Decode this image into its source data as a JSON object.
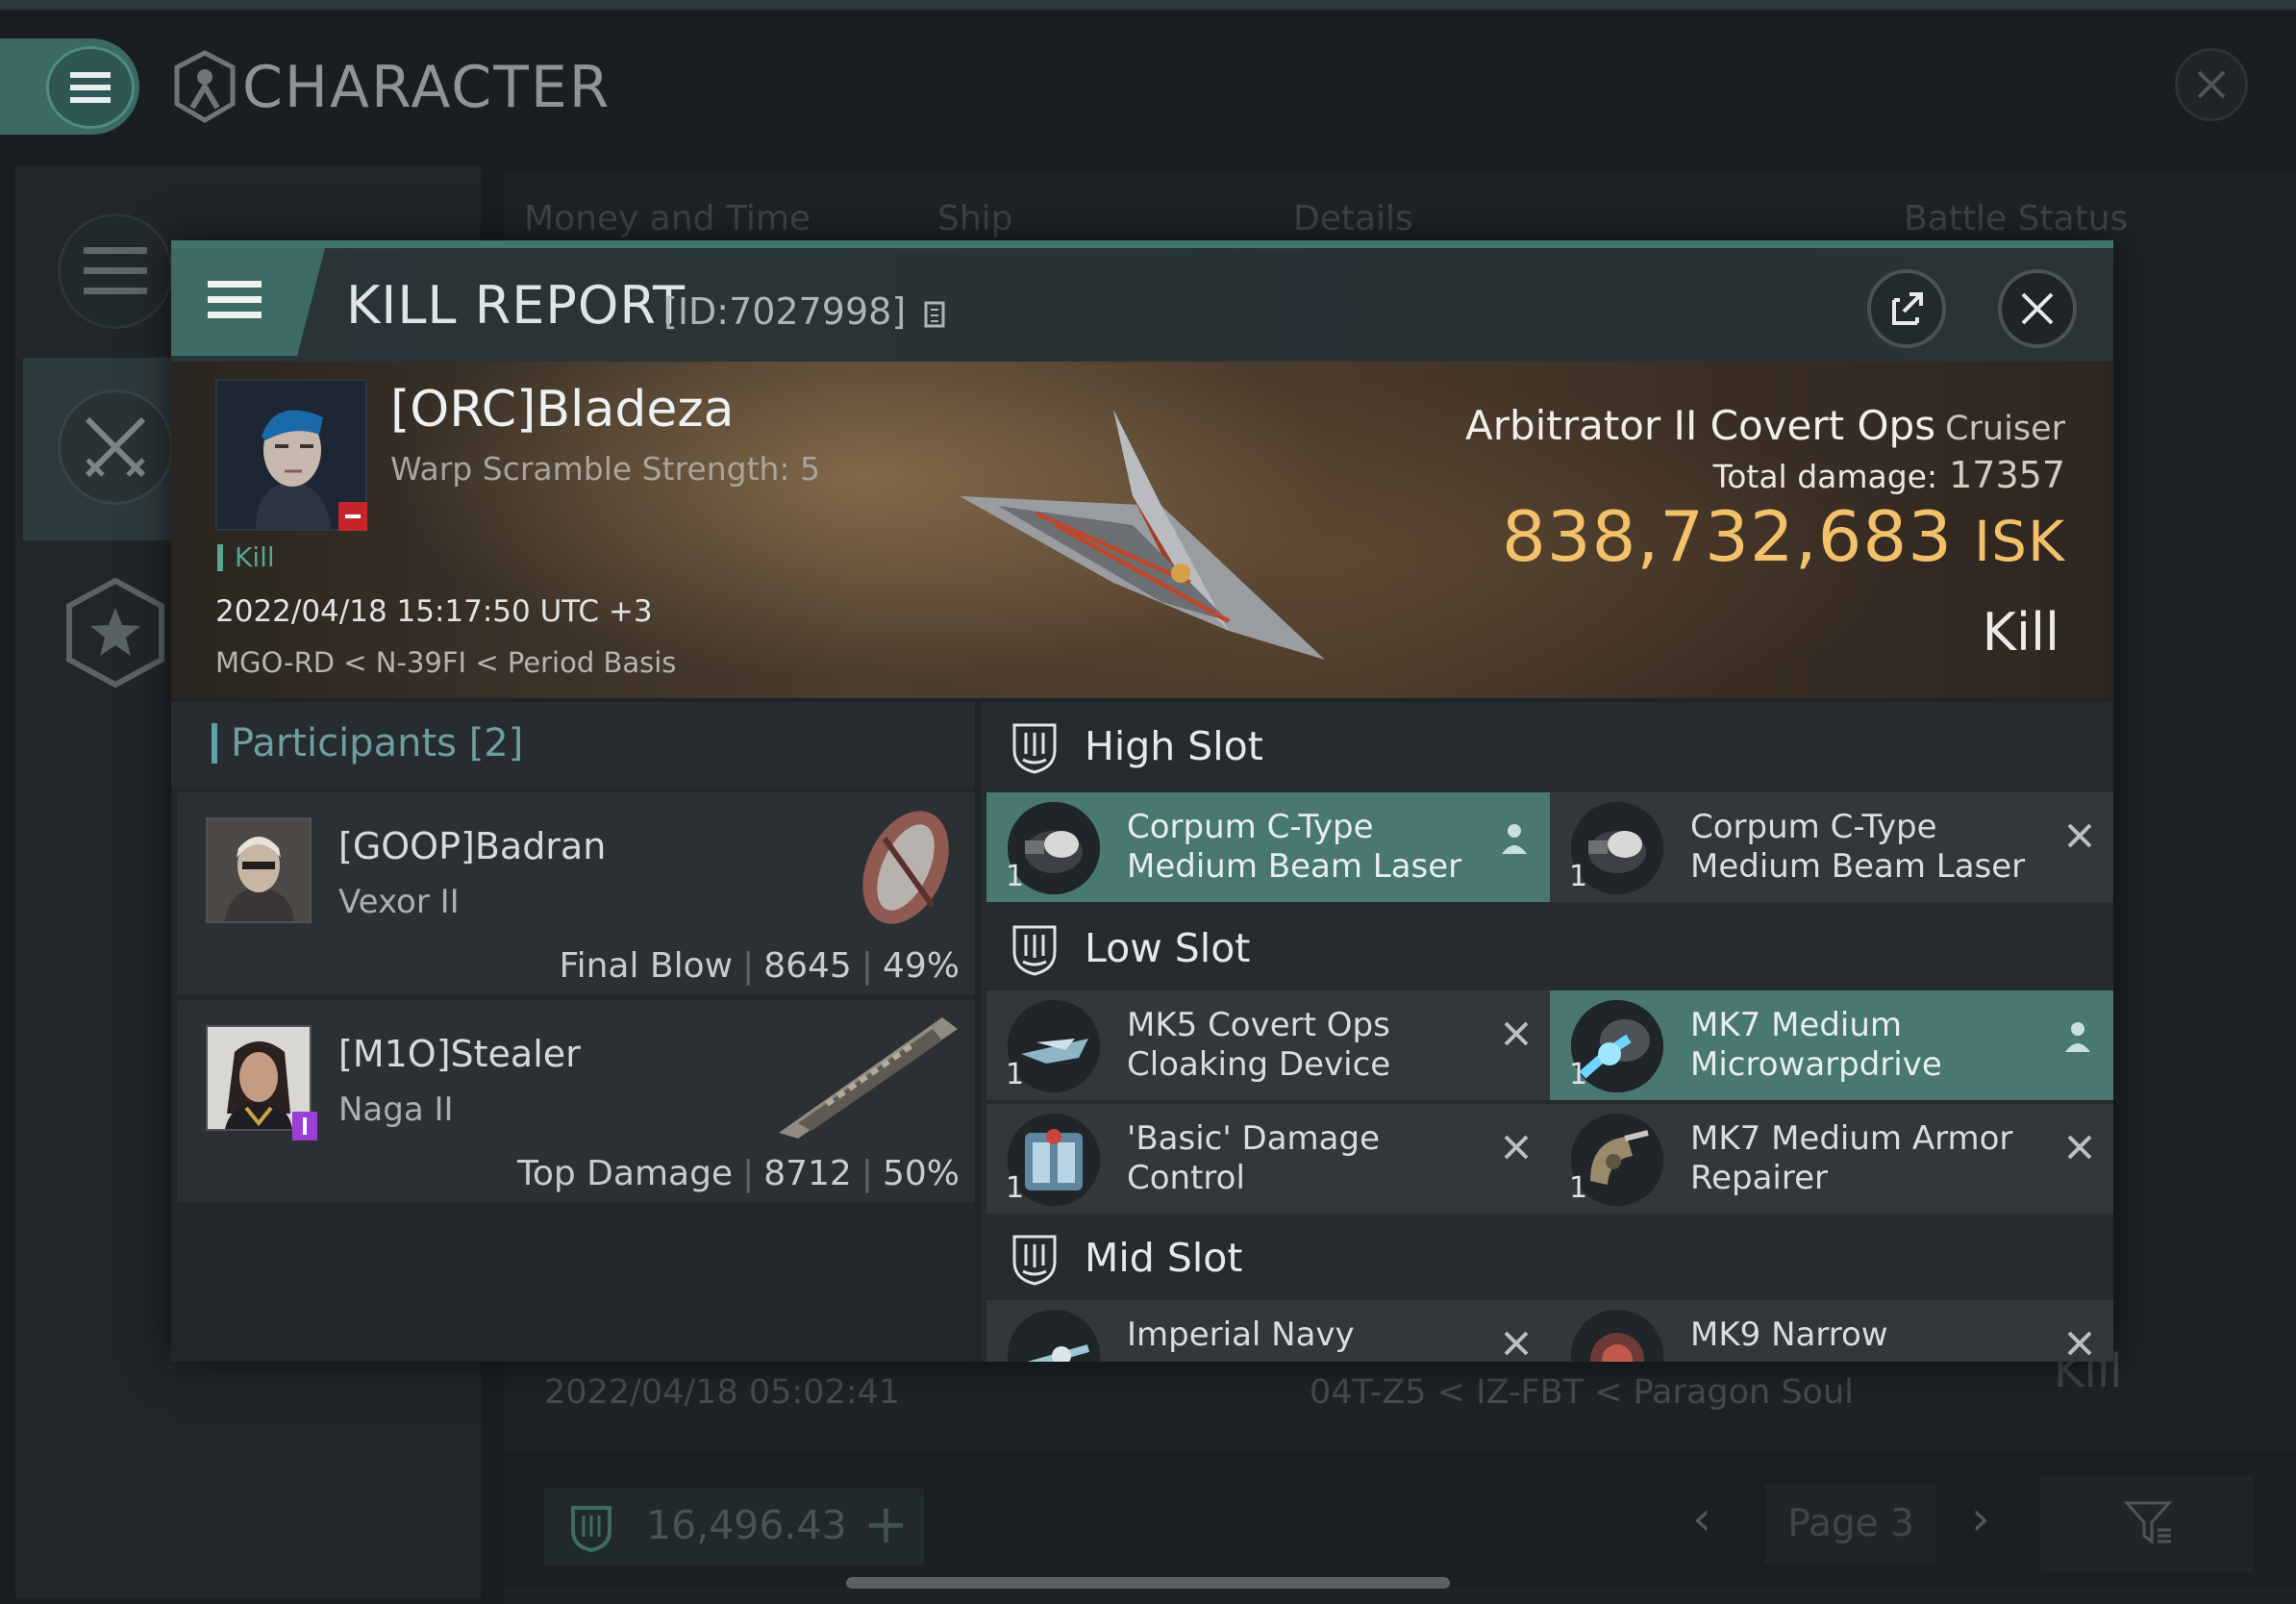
{
  "screen": {
    "title": "CHARACTER",
    "tabs": [
      "Money and Time",
      "Ship",
      "Details",
      "Battle Status"
    ],
    "background_row": {
      "date": "2022/04/18  05:02:41",
      "location": "04T-Z5 < IZ-FBT < Paragon Soul",
      "result": "Kill"
    },
    "wallet_value": "16,496.43",
    "page_label": "Page 3"
  },
  "kill_report": {
    "title": "KILL REPORT",
    "id_label": "[ID:7027998]",
    "victim": {
      "name": "[ORC]Bladeza",
      "warp_scramble": "Warp Scramble Strength: 5",
      "tag": "Kill",
      "time": "2022/04/18 15:17:50 UTC +3",
      "location": "MGO-RD < N-39FI < Period Basis"
    },
    "ship": {
      "name": "Arbitrator II Covert Ops",
      "class": "Cruiser",
      "total_damage_label": "Total damage:",
      "total_damage": "17357",
      "isk_value": "838,732,683",
      "isk_unit": "ISK",
      "result": "Kill"
    },
    "participants": {
      "title": "Participants",
      "count": "[2]",
      "items": [
        {
          "name": "[GOOP]Badran",
          "ship": "Vexor II",
          "role": "Final Blow",
          "damage": "8645",
          "percent": "49%"
        },
        {
          "name": "[M1O]Stealer",
          "ship": "Naga II",
          "role": "Top Damage",
          "damage": "8712",
          "percent": "50%"
        }
      ]
    },
    "slots": {
      "high": {
        "label": "High Slot",
        "modules": [
          {
            "name": "Corpum C-Type Medium Beam Laser",
            "qty": "1",
            "state": "dropped"
          },
          {
            "name": "Corpum C-Type Medium Beam Laser",
            "qty": "1",
            "state": "destroyed"
          }
        ]
      },
      "low": {
        "label": "Low Slot",
        "modules": [
          {
            "name": "MK5 Covert Ops Cloaking Device",
            "qty": "1",
            "state": "destroyed"
          },
          {
            "name": "MK7 Medium Microwarpdrive",
            "qty": "1",
            "state": "dropped"
          },
          {
            "name": "'Basic' Damage Control",
            "qty": "1",
            "state": "destroyed"
          },
          {
            "name": "MK7 Medium Armor Repairer",
            "qty": "1",
            "state": "destroyed"
          }
        ]
      },
      "mid": {
        "label": "Mid Slot",
        "modules": [
          {
            "name": "Imperial Navy",
            "state": "destroyed"
          },
          {
            "name": "MK9 Narrow",
            "state": "destroyed"
          }
        ]
      }
    }
  },
  "colors": {
    "accent_teal": "#497872",
    "isk_gold": "#f2c16a",
    "kill_green": "#58a592"
  }
}
